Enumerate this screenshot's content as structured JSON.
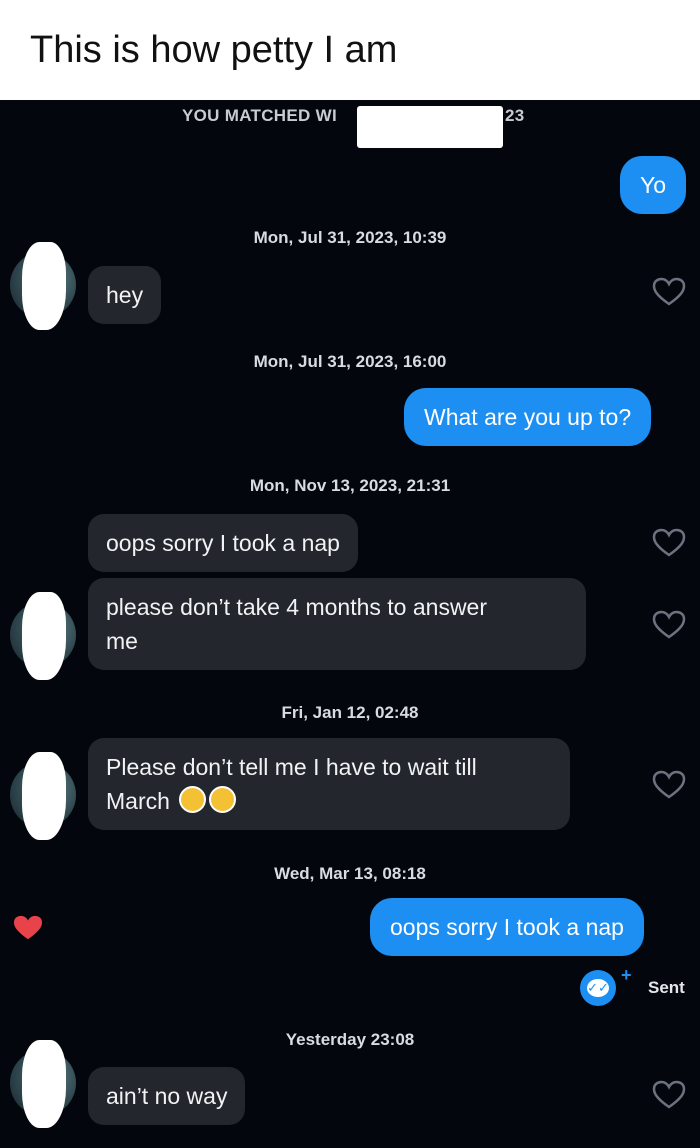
{
  "caption": "This is how petty I am",
  "banner": {
    "prefix": "YOU MATCHED WI",
    "suffix": "23"
  },
  "timestamps": [
    "Mon, Jul 31, 2023, 10:39",
    "Mon, Jul 31, 2023, 16:00",
    "Mon, Nov 13, 2023, 21:31",
    "Fri, Jan 12, 02:48",
    "Wed, Mar 13, 08:18",
    "Yesterday 23:08"
  ],
  "messages": [
    {
      "from": "me",
      "text": "Yo"
    },
    {
      "from": "them",
      "text": "hey"
    },
    {
      "from": "me",
      "text": "What are you up to?"
    },
    {
      "from": "them",
      "text": "oops sorry I took a nap"
    },
    {
      "from": "them",
      "line1": "please don’t take 4 months to answer",
      "line2": "me"
    },
    {
      "from": "them",
      "line1": "Please don’t tell me I have to wait till",
      "line2": "March",
      "emoji": "crying-face x2"
    },
    {
      "from": "me",
      "text": "oops sorry I took a nap",
      "liked": true
    },
    {
      "from": "them",
      "text": "ain’t no way"
    }
  ],
  "status": {
    "label": "Sent",
    "badge": "✓✓"
  },
  "colors": {
    "outgoing": "#1d8ff2",
    "incoming": "#23262d",
    "background": "#03070d",
    "like": "#e8434b"
  }
}
